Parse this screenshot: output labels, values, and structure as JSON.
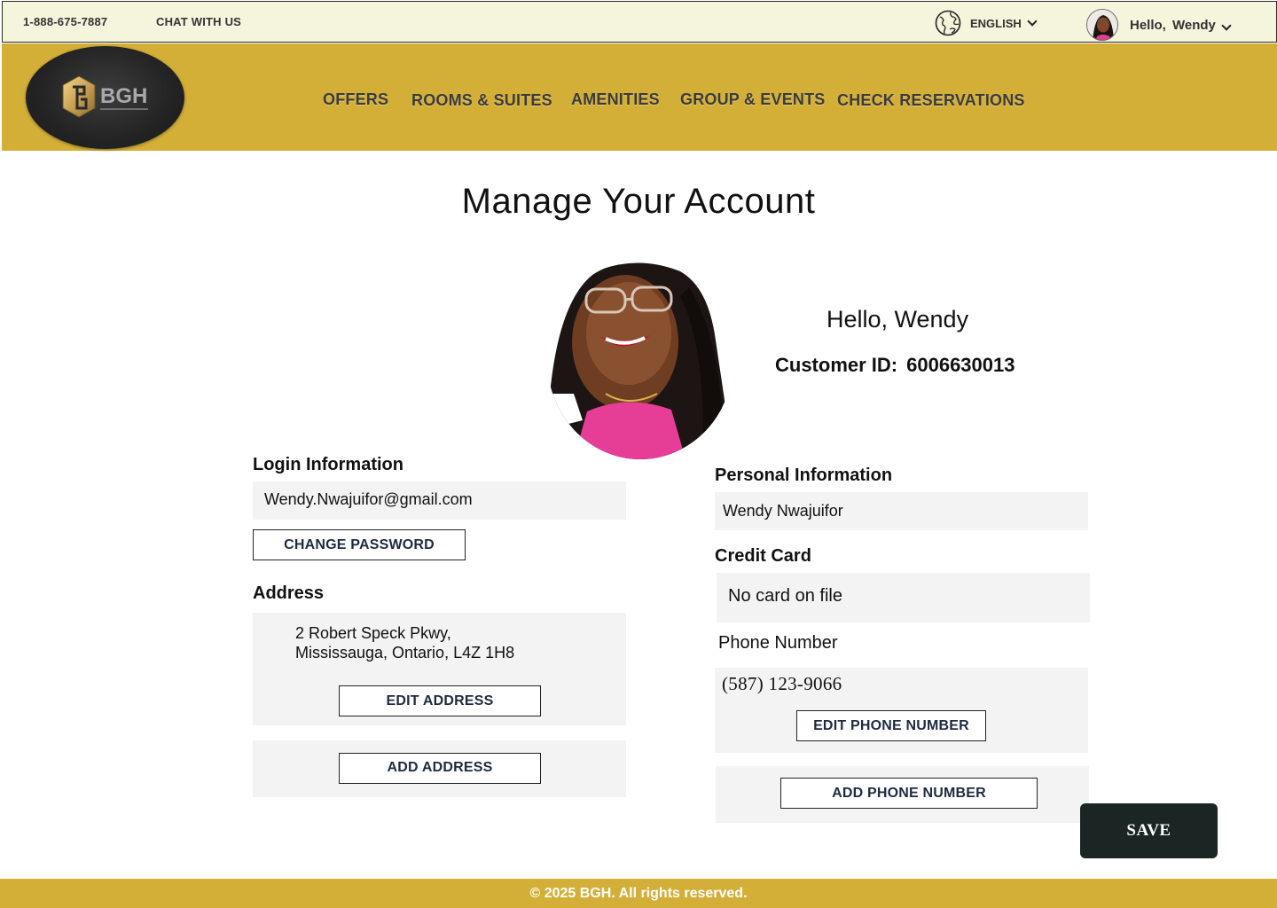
{
  "topbar": {
    "phone": "1-888-675-7887",
    "chat": "CHAT WITH US",
    "language": "ENGLISH",
    "greeting": "Hello,  Wendy"
  },
  "logo": {
    "text": "BGH"
  },
  "nav": {
    "offers": "OFFERS",
    "rooms": "ROOMS & SUITES",
    "amenities": "AMENITIES",
    "groups": "GROUP & EVENTS",
    "reservations": "CHECK RESERVATIONS"
  },
  "page": {
    "title": "Manage Your Account",
    "hello": "Hello, Wendy",
    "customer_id_label": "Customer ID:",
    "customer_id": "6006630013"
  },
  "login": {
    "label": "Login Information",
    "email": "Wendy.Nwajuifor@gmail.com",
    "change_password": "CHANGE PASSWORD"
  },
  "address": {
    "label": "Address",
    "line1": "2 Robert Speck Pkwy,",
    "line2": "Mississauga, Ontario, L4Z 1H8",
    "edit": "EDIT ADDRESS",
    "add": "ADD ADDRESS"
  },
  "personal": {
    "label": "Personal Information",
    "name": "Wendy Nwajuifor"
  },
  "credit_card": {
    "label": "Credit Card",
    "value": "No card on file"
  },
  "phone": {
    "label": "Phone Number",
    "value": "(587) 123-9066",
    "edit": "EDIT PHONE NUMBER",
    "add": "ADD  PHONE NUMBER"
  },
  "actions": {
    "save": "SAVE"
  },
  "footer": {
    "text": "© 2025 BGH. All rights reserved."
  },
  "colors": {
    "gold": "#d4af37",
    "topbar_bg": "#f5f4dc",
    "save_bg": "#1a2524",
    "field_bg": "#f3f3f3"
  },
  "icons": {
    "globe": "globe-icon",
    "chevron": "chevron-down-icon"
  }
}
